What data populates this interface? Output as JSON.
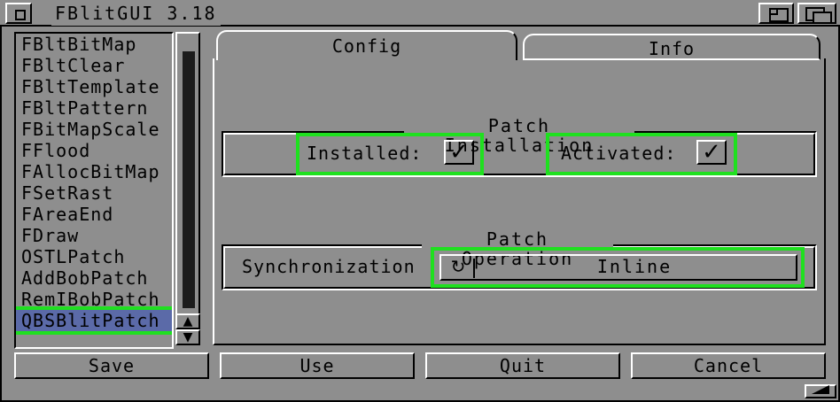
{
  "window": {
    "title": "FBlitGUI 3.18"
  },
  "list": {
    "items": [
      "FBltBitMap",
      "FBltClear",
      "FBltTemplate",
      "FBltPattern",
      "FBitMapScale",
      "FFlood",
      "FAllocBitMap",
      "FSetRast",
      "FAreaEnd",
      "FDraw",
      "OSTLPatch",
      "AddBobPatch",
      "RemIBobPatch",
      "QBSBlitPatch"
    ],
    "selected": "QBSBlitPatch"
  },
  "tabs": [
    {
      "label": "Config",
      "active": true
    },
    {
      "label": "Info",
      "active": false
    }
  ],
  "patch_installation": {
    "title": "Patch Installation",
    "installed_label": "Installed:",
    "installed_checked": true,
    "activated_label": "Activated:",
    "activated_checked": true
  },
  "patch_operation": {
    "title": "Patch Operation",
    "sync_label": "Synchronization",
    "sync_value": "Inline"
  },
  "buttons": {
    "save": "Save",
    "use": "Use",
    "quit": "Quit",
    "cancel": "Cancel"
  },
  "colors": {
    "background": "#8e8e8e",
    "selection": "#5b6aa8",
    "highlight_outline": "#1fe01f"
  },
  "icons": {
    "close": "close-icon",
    "zoom": "zoom-icon",
    "depth": "depth-icon",
    "checkmark": "checkmark-icon",
    "cycle": "cycle-icon",
    "resize": "resize-icon"
  }
}
